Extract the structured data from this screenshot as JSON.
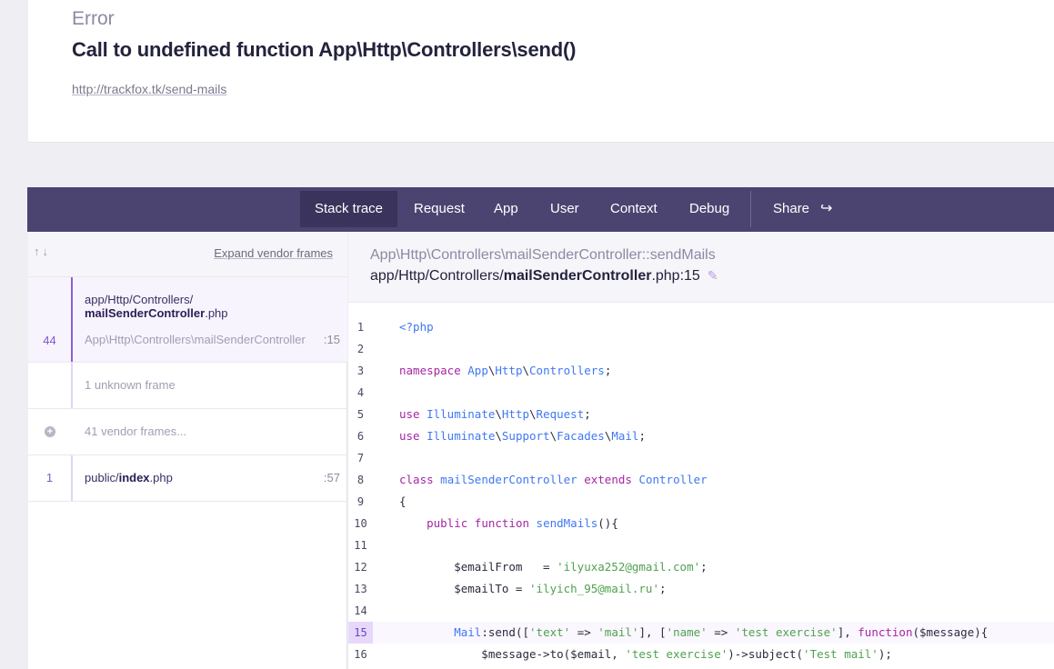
{
  "error": {
    "label": "Error",
    "message": "Call to undefined function App\\Http\\Controllers\\send()",
    "url": "http://trackfox.tk/send-mails"
  },
  "tabs": [
    {
      "label": "Stack trace",
      "active": true
    },
    {
      "label": "Request"
    },
    {
      "label": "App"
    },
    {
      "label": "User"
    },
    {
      "label": "Context"
    },
    {
      "label": "Debug"
    },
    {
      "label": "Share"
    }
  ],
  "frames_panel": {
    "expand_label": "Expand vendor frames",
    "frames": [
      {
        "number": "44",
        "path_dir": "app/Http/Controllers/",
        "path_file": "mailSenderController",
        "path_ext": ".php",
        "class": "App\\Http\\Controllers\\mailSenderController",
        "line": ":15"
      },
      {
        "text": "1 unknown frame"
      },
      {
        "text": "41 vendor frames..."
      },
      {
        "number": "1",
        "path_dir": "public/",
        "path_file": "index",
        "path_ext": ".php",
        "line": ":57"
      }
    ]
  },
  "editor": {
    "class_path": "App\\Http\\Controllers\\mailSenderController",
    "method": "::sendMails",
    "file_dir": "app/Http/Controllers/",
    "file_name": "mailSenderController",
    "file_ext": ".php:15",
    "highlight_line": 15,
    "lines": [
      {
        "n": "1",
        "code": "<?php"
      },
      {
        "n": "2",
        "code": ""
      },
      {
        "n": "3",
        "code": "namespace App\\Http\\Controllers;"
      },
      {
        "n": "4",
        "code": ""
      },
      {
        "n": "5",
        "code": "use Illuminate\\Http\\Request;"
      },
      {
        "n": "6",
        "code": "use Illuminate\\Support\\Facades\\Mail;"
      },
      {
        "n": "7",
        "code": ""
      },
      {
        "n": "8",
        "code": "class mailSenderController extends Controller"
      },
      {
        "n": "9",
        "code": "{"
      },
      {
        "n": "10",
        "code": "    public function sendMails(){"
      },
      {
        "n": "11",
        "code": ""
      },
      {
        "n": "12",
        "code": "        $emailFrom   = 'ilyuxa252@gmail.com';"
      },
      {
        "n": "13",
        "code": "        $emailTo = 'ilyich_95@mail.ru';"
      },
      {
        "n": "14",
        "code": ""
      },
      {
        "n": "15",
        "code": "        Mail:send(['text' => 'mail'], ['name' => 'test exercise'], function($message){"
      },
      {
        "n": "16",
        "code": "            $message->to($email, 'test exercise')->subject('Test mail');"
      }
    ]
  },
  "colors": {
    "tabbar": "#4c4470",
    "accent": "#8b5fd6",
    "keyword": "#a626a4",
    "type": "#4078f2",
    "string": "#50a14f"
  }
}
